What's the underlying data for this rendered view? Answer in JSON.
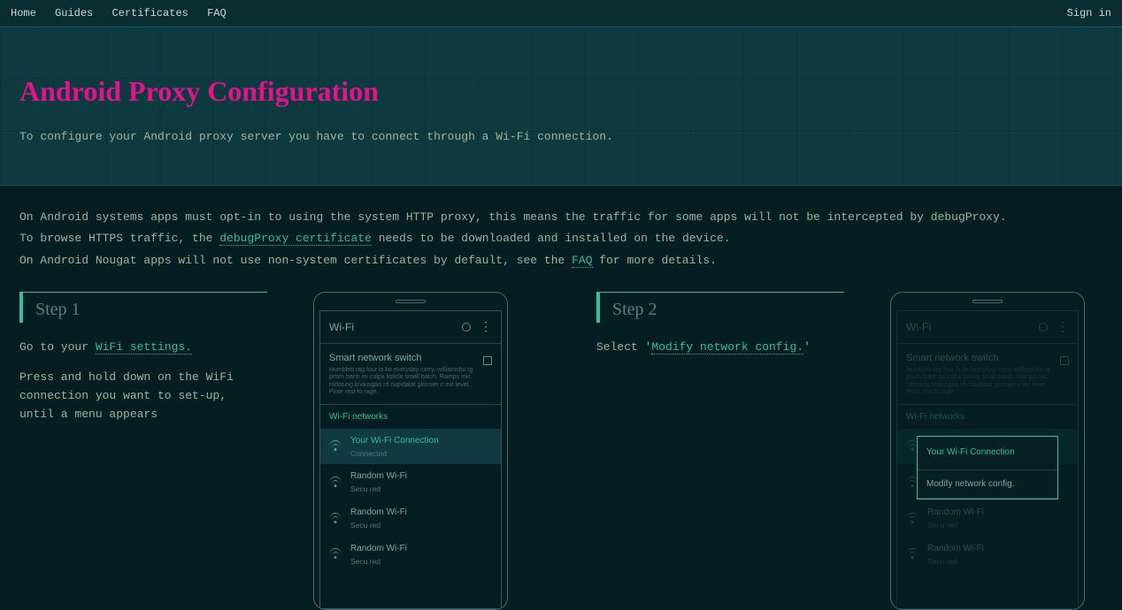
{
  "nav": {
    "home": "Home",
    "guides": "Guides",
    "certificates": "Certificates",
    "faq": "FAQ",
    "signin": "Sign in"
  },
  "hero": {
    "title": "Android Proxy Configuration",
    "subtitle": "To configure your Android proxy server you have to connect through a Wi-Fi connection."
  },
  "intro": {
    "l1a": "On Android systems apps must opt-in to using the system HTTP proxy, this means the traffic for some apps will not be intercepted by debugProxy.",
    "l2a": "To browse HTTPS traffic, the ",
    "l2link": "debugProxy certificate",
    "l2b": " needs to be downloaded and installed on the device.",
    "l3a": "On Android Nougat apps will not use non-system certificates by default, see the ",
    "l3link": "FAQ",
    "l3b": " for more details."
  },
  "step1": {
    "heading": "Step 1",
    "p1a": "Go to your ",
    "p1link": "WiFi settings.",
    "p2": "Press and hold down on the WiFi connection you want to set-up, until a menu appears"
  },
  "step2": {
    "heading": "Step 2",
    "p1a": "Select '",
    "p1link": "Modify network config.",
    "p1b": "'"
  },
  "phone": {
    "wifi_label": "Wi-Fi",
    "sns_title": "Smart network switch",
    "sns_sub": "Humbleb rag four lo ko everyday carry, williamsbu rg prism banh mi culpa listicle small batch. Ramps mic rodosing knausgaa rd cupidatat glossier n ext level. Pinte rest fo rage.",
    "networks_label": "Wi-Fi networks",
    "your_conn": "Your Wi-Fi Connection",
    "connected": "Connected",
    "random": "Random Wi-Fi",
    "secured": "Secu red"
  },
  "popup": {
    "title": "Your Wi-Fi Connection",
    "item": "Modify network config."
  }
}
